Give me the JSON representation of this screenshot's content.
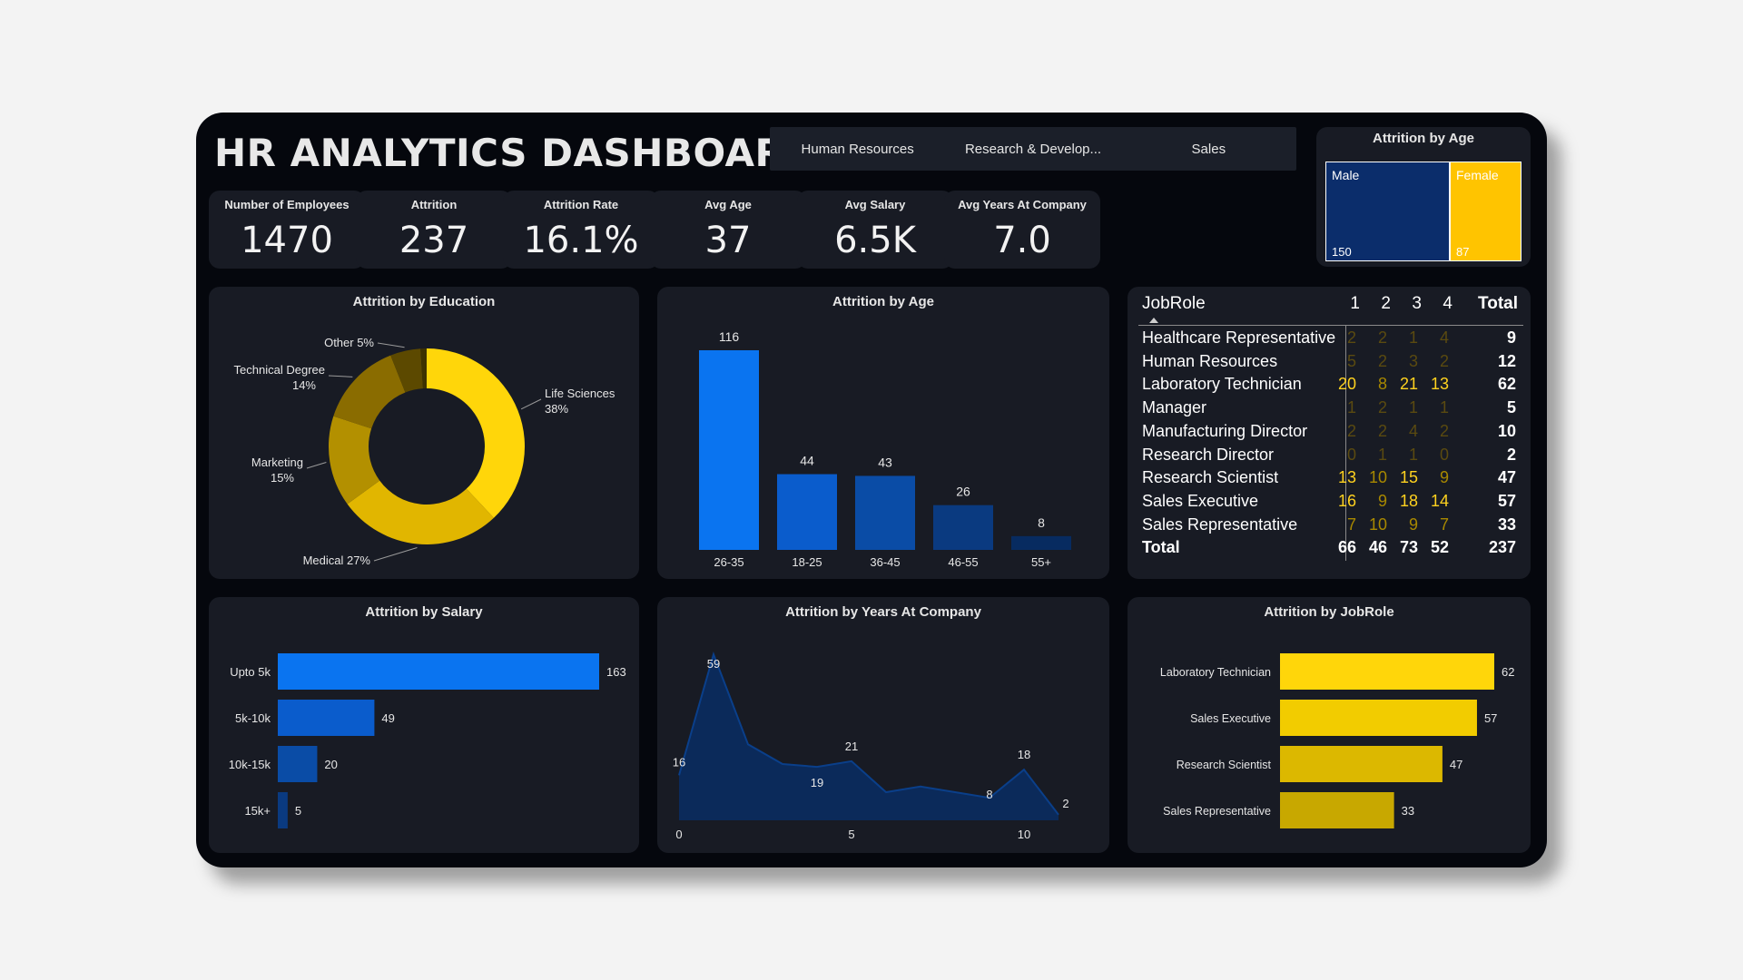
{
  "title": "HR ANALYTICS DASHBOARD",
  "slicer": [
    "Human Resources",
    "Research & Develop...",
    "Sales"
  ],
  "kpis": [
    {
      "label": "Number of Employees",
      "value": "1470"
    },
    {
      "label": "Attrition",
      "value": "237"
    },
    {
      "label": "Attrition Rate",
      "value": "16.1%"
    },
    {
      "label": "Avg Age",
      "value": "37"
    },
    {
      "label": "Avg Salary",
      "value": "6.5K"
    },
    {
      "label": "Avg Years At Company",
      "value": "7.0"
    }
  ],
  "gender_treemap": {
    "title": "Attrition by Age",
    "items": [
      {
        "label": "Male",
        "value": 150,
        "color": "#0b2d6b"
      },
      {
        "label": "Female",
        "value": 87,
        "color": "#ffc400"
      }
    ]
  },
  "colors": {
    "blue": "#0a74f0",
    "yellow": "#ffd700"
  },
  "chart_data": [
    {
      "id": "education",
      "type": "pie",
      "title": "Attrition by Education",
      "slices": [
        {
          "label": "Life Sciences",
          "pct_label": "38%",
          "value": 38,
          "color": "#ffd60a"
        },
        {
          "label": "Medical",
          "pct_label": "27%",
          "value": 27,
          "color": "#e1b600"
        },
        {
          "label": "Marketing",
          "pct_label": "15%",
          "value": 15,
          "color": "#b39000"
        },
        {
          "label": "Technical Degree",
          "pct_label": "14%",
          "value": 14,
          "color": "#8a6c00"
        },
        {
          "label": "Other",
          "pct_label": "5%",
          "value": 5,
          "color": "#5c4900"
        },
        {
          "label": "",
          "pct_label": "",
          "value": 1,
          "color": "#3e3200"
        }
      ]
    },
    {
      "id": "age",
      "type": "bar",
      "title": "Attrition by Age",
      "categories": [
        "26-35",
        "18-25",
        "36-45",
        "46-55",
        "55+"
      ],
      "values": [
        116,
        44,
        43,
        26,
        8
      ],
      "colors": [
        "#0a74f0",
        "#0a5ccc",
        "#0a4ca6",
        "#0a3a80",
        "#072b60"
      ],
      "ylim": [
        0,
        116
      ]
    },
    {
      "id": "salary",
      "type": "bar",
      "orientation": "horizontal",
      "title": "Attrition by Salary",
      "categories": [
        "Upto 5k",
        "5k-10k",
        "10k-15k",
        "15k+"
      ],
      "values": [
        163,
        49,
        20,
        5
      ],
      "colors": [
        "#0a74f0",
        "#0a5ccc",
        "#0a4ca6",
        "#0a3a80"
      ],
      "xlim": [
        0,
        163
      ]
    },
    {
      "id": "years",
      "type": "area",
      "title": "Attrition by Years At Company",
      "x": [
        0,
        1,
        2,
        3,
        4,
        5,
        6,
        7,
        8,
        9,
        10,
        11
      ],
      "values": [
        16,
        59,
        27,
        20,
        19,
        21,
        10,
        12,
        10,
        8,
        18,
        2
      ],
      "labeled_points": [
        0,
        1,
        4,
        5,
        9,
        10,
        11
      ],
      "xticks": [
        0,
        5,
        10
      ],
      "color": "#0b2a5a",
      "line_color": "#0a3f8a"
    },
    {
      "id": "jobrole",
      "type": "bar",
      "orientation": "horizontal",
      "title": "Attrition by JobRole",
      "categories": [
        "Laboratory Technician",
        "Sales Executive",
        "Research Scientist",
        "Sales Representative"
      ],
      "values": [
        62,
        57,
        47,
        33
      ],
      "colors": [
        "#ffd60a",
        "#f2cc00",
        "#dcb800",
        "#c8a800"
      ],
      "xlim": [
        0,
        62
      ]
    }
  ],
  "matrix": {
    "header": [
      "JobRole",
      "1",
      "2",
      "3",
      "4",
      "Total"
    ],
    "rows": [
      {
        "role": "Healthcare Representative",
        "vals": [
          "2",
          "2",
          "1",
          "4"
        ],
        "total": "9"
      },
      {
        "role": "Human Resources",
        "vals": [
          "5",
          "2",
          "3",
          "2"
        ],
        "total": "12"
      },
      {
        "role": "Laboratory Technician",
        "vals": [
          "20",
          "8",
          "21",
          "13"
        ],
        "total": "62"
      },
      {
        "role": "Manager",
        "vals": [
          "1",
          "2",
          "1",
          "1"
        ],
        "total": "5"
      },
      {
        "role": "Manufacturing Director",
        "vals": [
          "2",
          "2",
          "4",
          "2"
        ],
        "total": "10"
      },
      {
        "role": "Research Director",
        "vals": [
          "0",
          "1",
          "1",
          "0"
        ],
        "total": "2"
      },
      {
        "role": "Research Scientist",
        "vals": [
          "13",
          "10",
          "15",
          "9"
        ],
        "total": "47"
      },
      {
        "role": "Sales Executive",
        "vals": [
          "16",
          "9",
          "18",
          "14"
        ],
        "total": "57"
      },
      {
        "role": "Sales Representative",
        "vals": [
          "7",
          "10",
          "9",
          "7"
        ],
        "total": "33"
      }
    ],
    "total_row": {
      "role": "Total",
      "vals": [
        "66",
        "46",
        "73",
        "52"
      ],
      "total": "237"
    }
  }
}
